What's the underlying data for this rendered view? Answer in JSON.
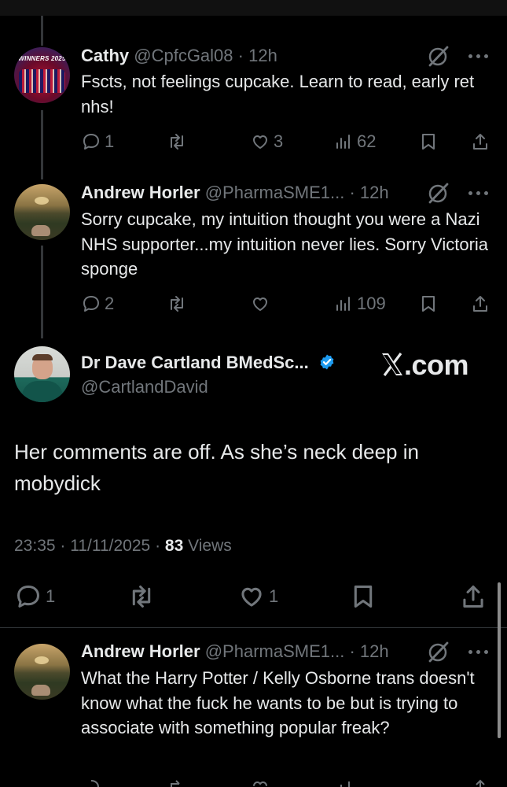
{
  "brand": {
    "site": ".com",
    "accent": "#1d9bf0",
    "muted": "#71767b",
    "background": "#000000"
  },
  "replies": [
    {
      "name": "Cathy",
      "handle": "@CpfcGal08",
      "time": "· 12h",
      "avatar_text": "WINNERS 2025",
      "text": "Fscts, not feelings cupcake.  Learn to read, early ret nhs!",
      "counts": {
        "replies": "1",
        "reposts": "",
        "likes": "3",
        "views": "62"
      }
    },
    {
      "name": "Andrew Horler",
      "handle": "@PharmaSME1...",
      "time": "· 12h",
      "text": "Sorry cupcake, my intuition thought you were a Nazi NHS supporter...my intuition never lies. Sorry Victoria sponge",
      "counts": {
        "replies": "2",
        "reposts": "",
        "likes": "",
        "views": "109"
      }
    }
  ],
  "main_tweet": {
    "name": "Dr Dave Cartland BMedSc...",
    "handle": "@CartlandDavid",
    "text": "Her comments are off. As she’s neck deep in mobydick",
    "time": "23:35",
    "date": "11/11/2025",
    "views_count": "83",
    "views_label": "Views",
    "counts": {
      "replies": "1",
      "reposts": "",
      "likes": "1"
    }
  },
  "next_reply": {
    "name": "Andrew Horler",
    "handle": "@PharmaSME1...",
    "time": "· 12h",
    "text": "What the Harry Potter / Kelly Osborne trans doesn't know what the fuck he wants to be but is trying to associate with something popular freak?"
  },
  "icons": [
    "reply-icon",
    "repost-icon",
    "like-icon",
    "views-icon",
    "bookmark-icon",
    "share-icon",
    "grok-icon",
    "more-icon",
    "verified-icon",
    "x-logo-icon"
  ]
}
